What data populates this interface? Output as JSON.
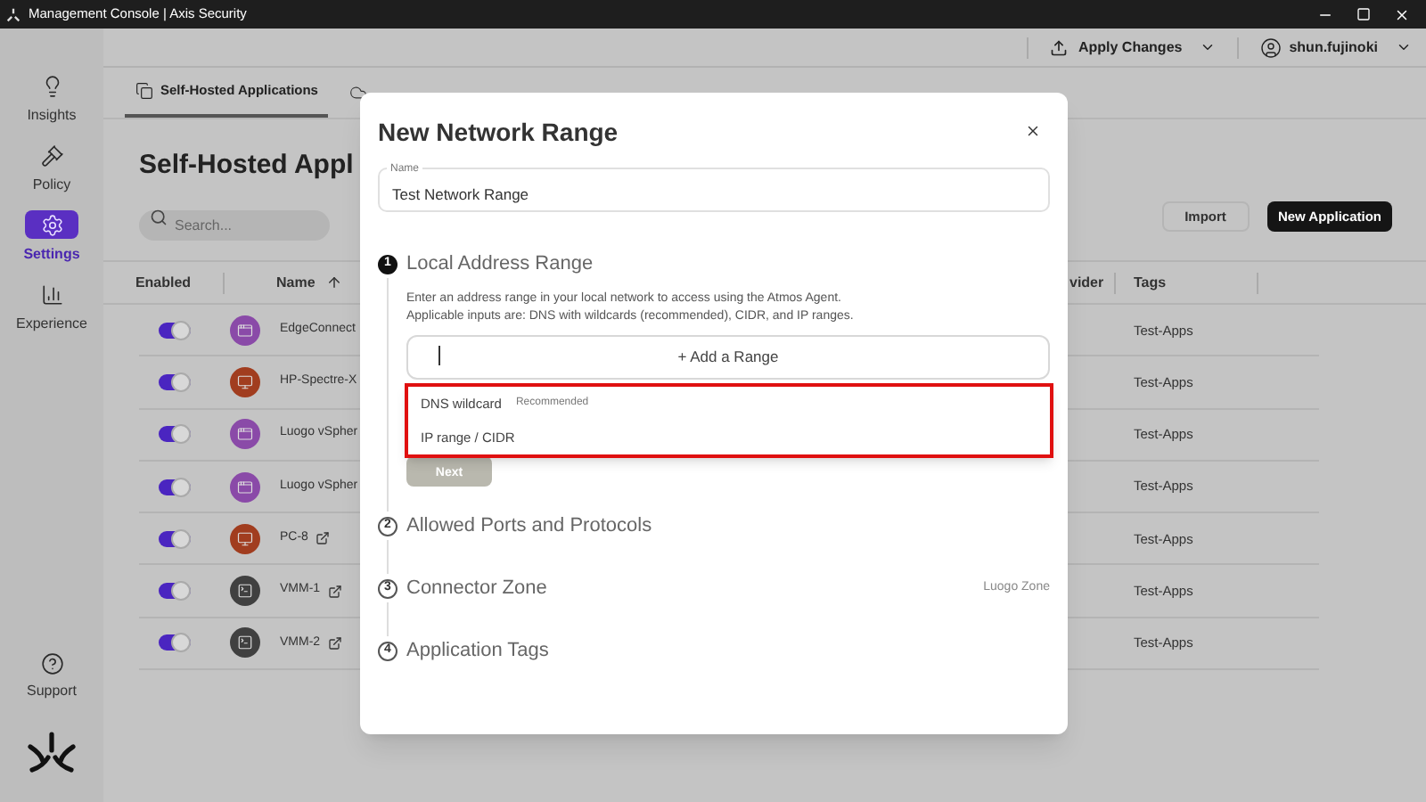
{
  "window": {
    "title": "Management Console | Axis Security"
  },
  "top_bar": {
    "apply_button": "Apply Changes",
    "user": "shun.fujinoki"
  },
  "sidebar": {
    "items": [
      {
        "label": "Insights",
        "kind": "bulb",
        "selected": false
      },
      {
        "label": "Policy",
        "kind": "gavel",
        "selected": false
      },
      {
        "label": "Settings",
        "kind": "gear",
        "selected": true
      },
      {
        "label": "Experience",
        "kind": "chart",
        "selected": false
      }
    ],
    "support": "Support"
  },
  "tabs": [
    {
      "label": "Self-Hosted Applications",
      "kind": "apps",
      "selected": true
    },
    {
      "kind": "cloud",
      "selected": false
    }
  ],
  "page": {
    "title": "Self-Hosted Appl",
    "search": {
      "placeholder": "Search..."
    },
    "buttons": [
      {
        "label": "Import",
        "kind": "secondary"
      },
      {
        "label": "New Application",
        "kind": "primary"
      }
    ]
  },
  "table": {
    "columns": [
      "Enabled",
      "Name",
      "vider",
      "Tags"
    ],
    "rows": [
      {
        "enabled": true,
        "kind": "web",
        "name": "EdgeConnect",
        "external_link": false,
        "tags": "Test-Apps"
      },
      {
        "enabled": true,
        "kind": "desktop",
        "name": "HP-Spectre-X",
        "external_link": false,
        "tags": "Test-Apps"
      },
      {
        "enabled": true,
        "kind": "web",
        "name": "Luogo vSpher",
        "external_link": false,
        "tags": "Test-Apps"
      },
      {
        "enabled": true,
        "kind": "web",
        "name": "Luogo vSpher",
        "external_link": false,
        "tags": "Test-Apps"
      },
      {
        "enabled": true,
        "kind": "desktop",
        "name": "PC-8",
        "external_link": true,
        "tags": "Test-Apps"
      },
      {
        "enabled": true,
        "kind": "terminal",
        "name": "VMM-1",
        "external_link": true,
        "tags": "Test-Apps"
      },
      {
        "enabled": true,
        "kind": "terminal",
        "name": "VMM-2",
        "external_link": true,
        "tags": "Test-Apps"
      }
    ]
  },
  "dialog": {
    "title": "New Network Range",
    "name_field": {
      "label": "Name",
      "value": "Test Network Range"
    },
    "steps": [
      {
        "number": "1",
        "title": "Local Address Range",
        "active": true
      },
      {
        "number": "2",
        "title": "Allowed Ports and Protocols",
        "active": false
      },
      {
        "number": "3",
        "title": "Connector Zone",
        "active": false,
        "value": "Luogo Zone"
      },
      {
        "number": "4",
        "title": "Application Tags",
        "active": false
      }
    ],
    "description": [
      "Enter an address range in your local network to access using the Atmos Agent.",
      "Applicable inputs are: DNS with wildcards (recommended), CIDR, and IP ranges."
    ],
    "range_field": {
      "placeholder": "+ Add a Range"
    },
    "dropdown": {
      "highlighted": true,
      "options": [
        {
          "label": "DNS wildcard",
          "badge": "Recommended"
        },
        {
          "label": "IP range / CIDR"
        }
      ]
    },
    "next_button": {
      "label": "Next",
      "disabled": true
    }
  }
}
